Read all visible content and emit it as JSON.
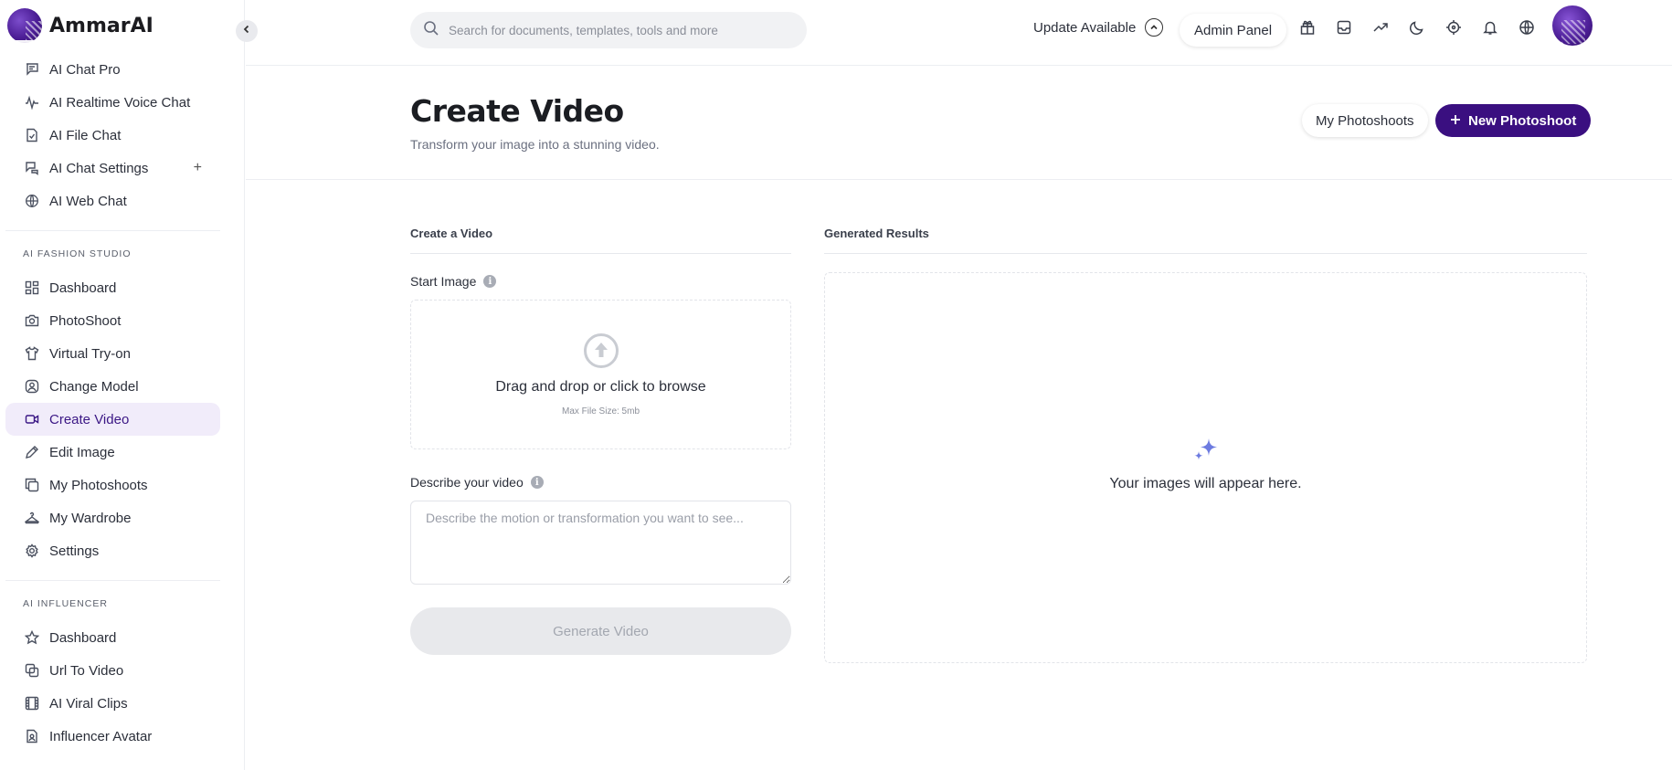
{
  "brand": {
    "name": "AmmarAI"
  },
  "sidebar": {
    "top_items": [
      {
        "label": "AI Chat Pro",
        "icon": "chat-lines-icon"
      },
      {
        "label": "AI Realtime Voice Chat",
        "icon": "waveform-icon"
      },
      {
        "label": "AI File Chat",
        "icon": "file-icon"
      },
      {
        "label": "AI Chat Settings",
        "icon": "chat-settings-icon",
        "has_plus": true
      },
      {
        "label": "AI Web Chat",
        "icon": "globe-www-icon"
      }
    ],
    "sections": [
      {
        "label": "AI FASHION STUDIO",
        "items": [
          {
            "label": "Dashboard",
            "icon": "grid-icon"
          },
          {
            "label": "PhotoShoot",
            "icon": "camera-icon"
          },
          {
            "label": "Virtual Try-on",
            "icon": "shirt-icon"
          },
          {
            "label": "Change Model",
            "icon": "user-circle-icon"
          },
          {
            "label": "Create Video",
            "icon": "video-icon",
            "active": true
          },
          {
            "label": "Edit Image",
            "icon": "pencil-icon"
          },
          {
            "label": "My Photoshoots",
            "icon": "copy-icon"
          },
          {
            "label": "My Wardrobe",
            "icon": "hanger-icon"
          },
          {
            "label": "Settings",
            "icon": "gear-icon"
          }
        ]
      },
      {
        "label": "AI INFLUENCER",
        "items": [
          {
            "label": "Dashboard",
            "icon": "star-icon"
          },
          {
            "label": "Url To Video",
            "icon": "copy-link-icon"
          },
          {
            "label": "AI Viral Clips",
            "icon": "film-icon"
          },
          {
            "label": "Influencer Avatar",
            "icon": "avatar-file-icon"
          }
        ]
      }
    ]
  },
  "topbar": {
    "search_placeholder": "Search for documents, templates, tools and more",
    "update_label": "Update Available",
    "admin_label": "Admin Panel",
    "icons": [
      "gift-icon",
      "inbox-icon",
      "trending-icon",
      "moon-icon",
      "crosshair-icon",
      "bell-icon",
      "globe-icon"
    ]
  },
  "page": {
    "title": "Create Video",
    "subtitle": "Transform your image into a stunning video.",
    "my_photoshoots_label": "My Photoshoots",
    "new_photoshoot_label": "New Photoshoot"
  },
  "form": {
    "heading": "Create a Video",
    "start_image_label": "Start Image",
    "drop_text": "Drag and drop or click to browse",
    "drop_sub": "Max File Size: 5mb",
    "describe_label": "Describe your video",
    "describe_placeholder": "Describe the motion or transformation you want to see...",
    "generate_label": "Generate Video"
  },
  "results": {
    "heading": "Generated Results",
    "empty_text": "Your images will appear here."
  },
  "colors": {
    "brand_primary": "#3a0f80",
    "active_bg": "#f1ecfa",
    "sparkle": "#6d7be0"
  }
}
